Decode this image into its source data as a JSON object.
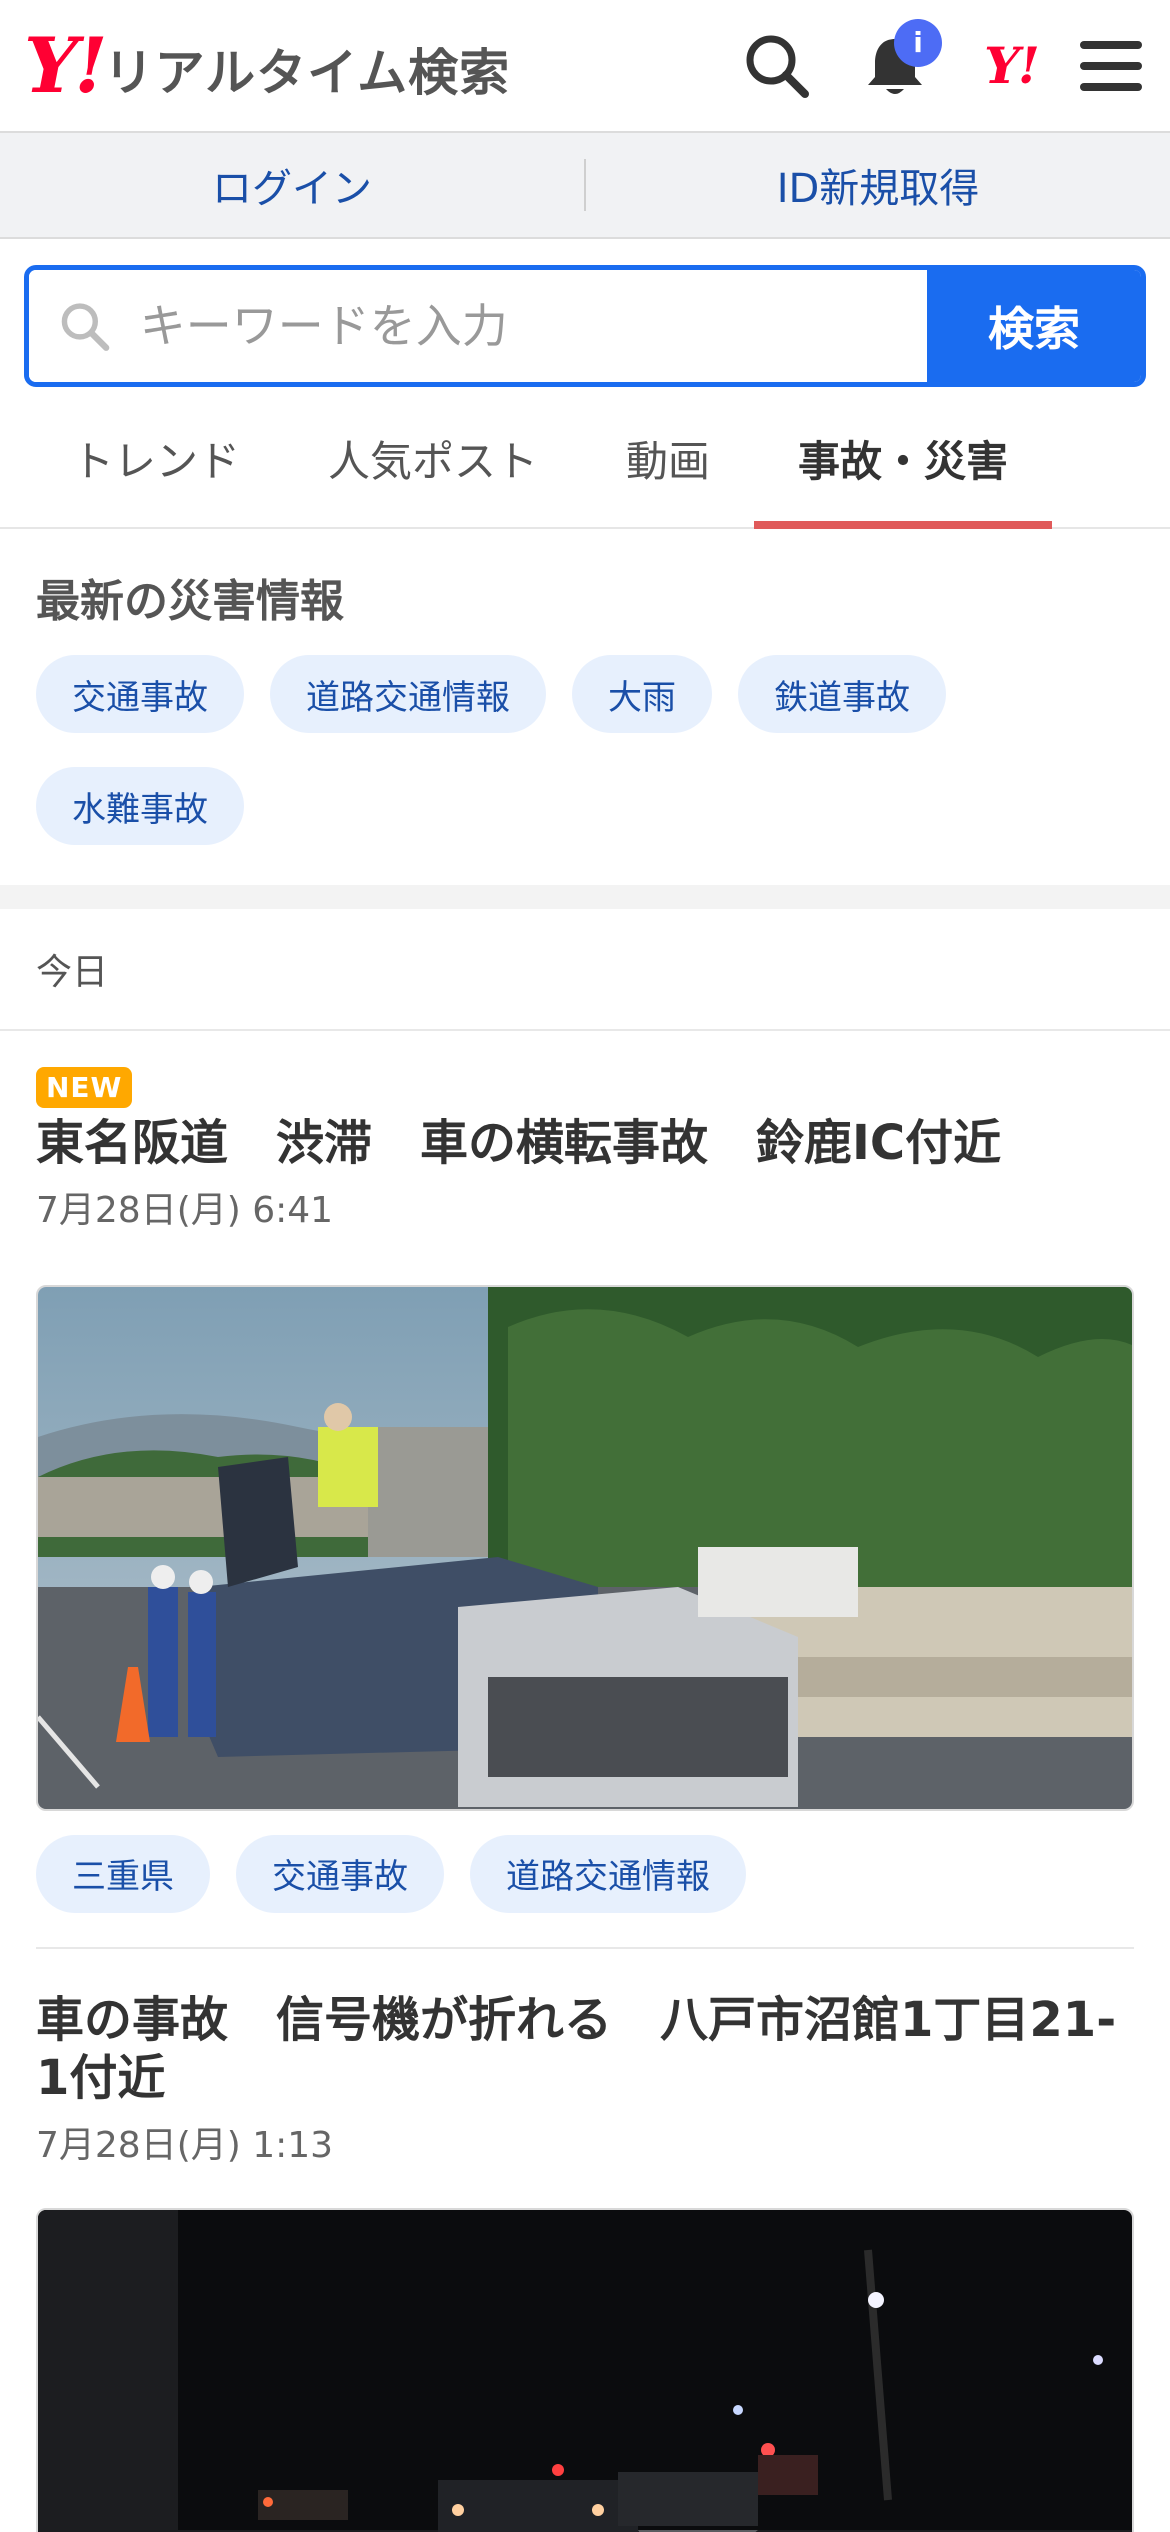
{
  "header": {
    "logo_mark": "Y!",
    "logo_text": "リアルタイム検索",
    "notification_badge": "i",
    "yahoo_mark": "Y!"
  },
  "login_bar": {
    "login_label": "ログイン",
    "signup_label": "ID新規取得"
  },
  "search": {
    "placeholder": "キーワードを入力",
    "button_label": "検索"
  },
  "tabs": [
    {
      "label": "トレンド",
      "active": false
    },
    {
      "label": "人気ポスト",
      "active": false
    },
    {
      "label": "動画",
      "active": false
    },
    {
      "label": "事故・災害",
      "active": true
    }
  ],
  "disaster": {
    "title": "最新の災害情報",
    "tags": [
      "交通事故",
      "道路交通情報",
      "大雨",
      "鉄道事故",
      "水難事故"
    ]
  },
  "today_label": "今日",
  "articles": [
    {
      "new_badge": "NEW",
      "title": "東名阪道　渋滞　車の横転事故　鈴鹿IC付近",
      "date": "7月28日(月) 6:41",
      "tags": [
        "三重県",
        "交通事故",
        "道路交通情報"
      ]
    },
    {
      "title": "車の事故　信号機が折れる　八戸市沼館1丁目21-1付近",
      "date": "7月28日(月) 1:13"
    }
  ],
  "colors": {
    "accent_blue": "#1a6cf0",
    "tab_underline": "#e05a5a",
    "yahoo_red": "#ff0033",
    "new_badge": "#ffa800",
    "chip_bg": "#e7f0fd"
  }
}
